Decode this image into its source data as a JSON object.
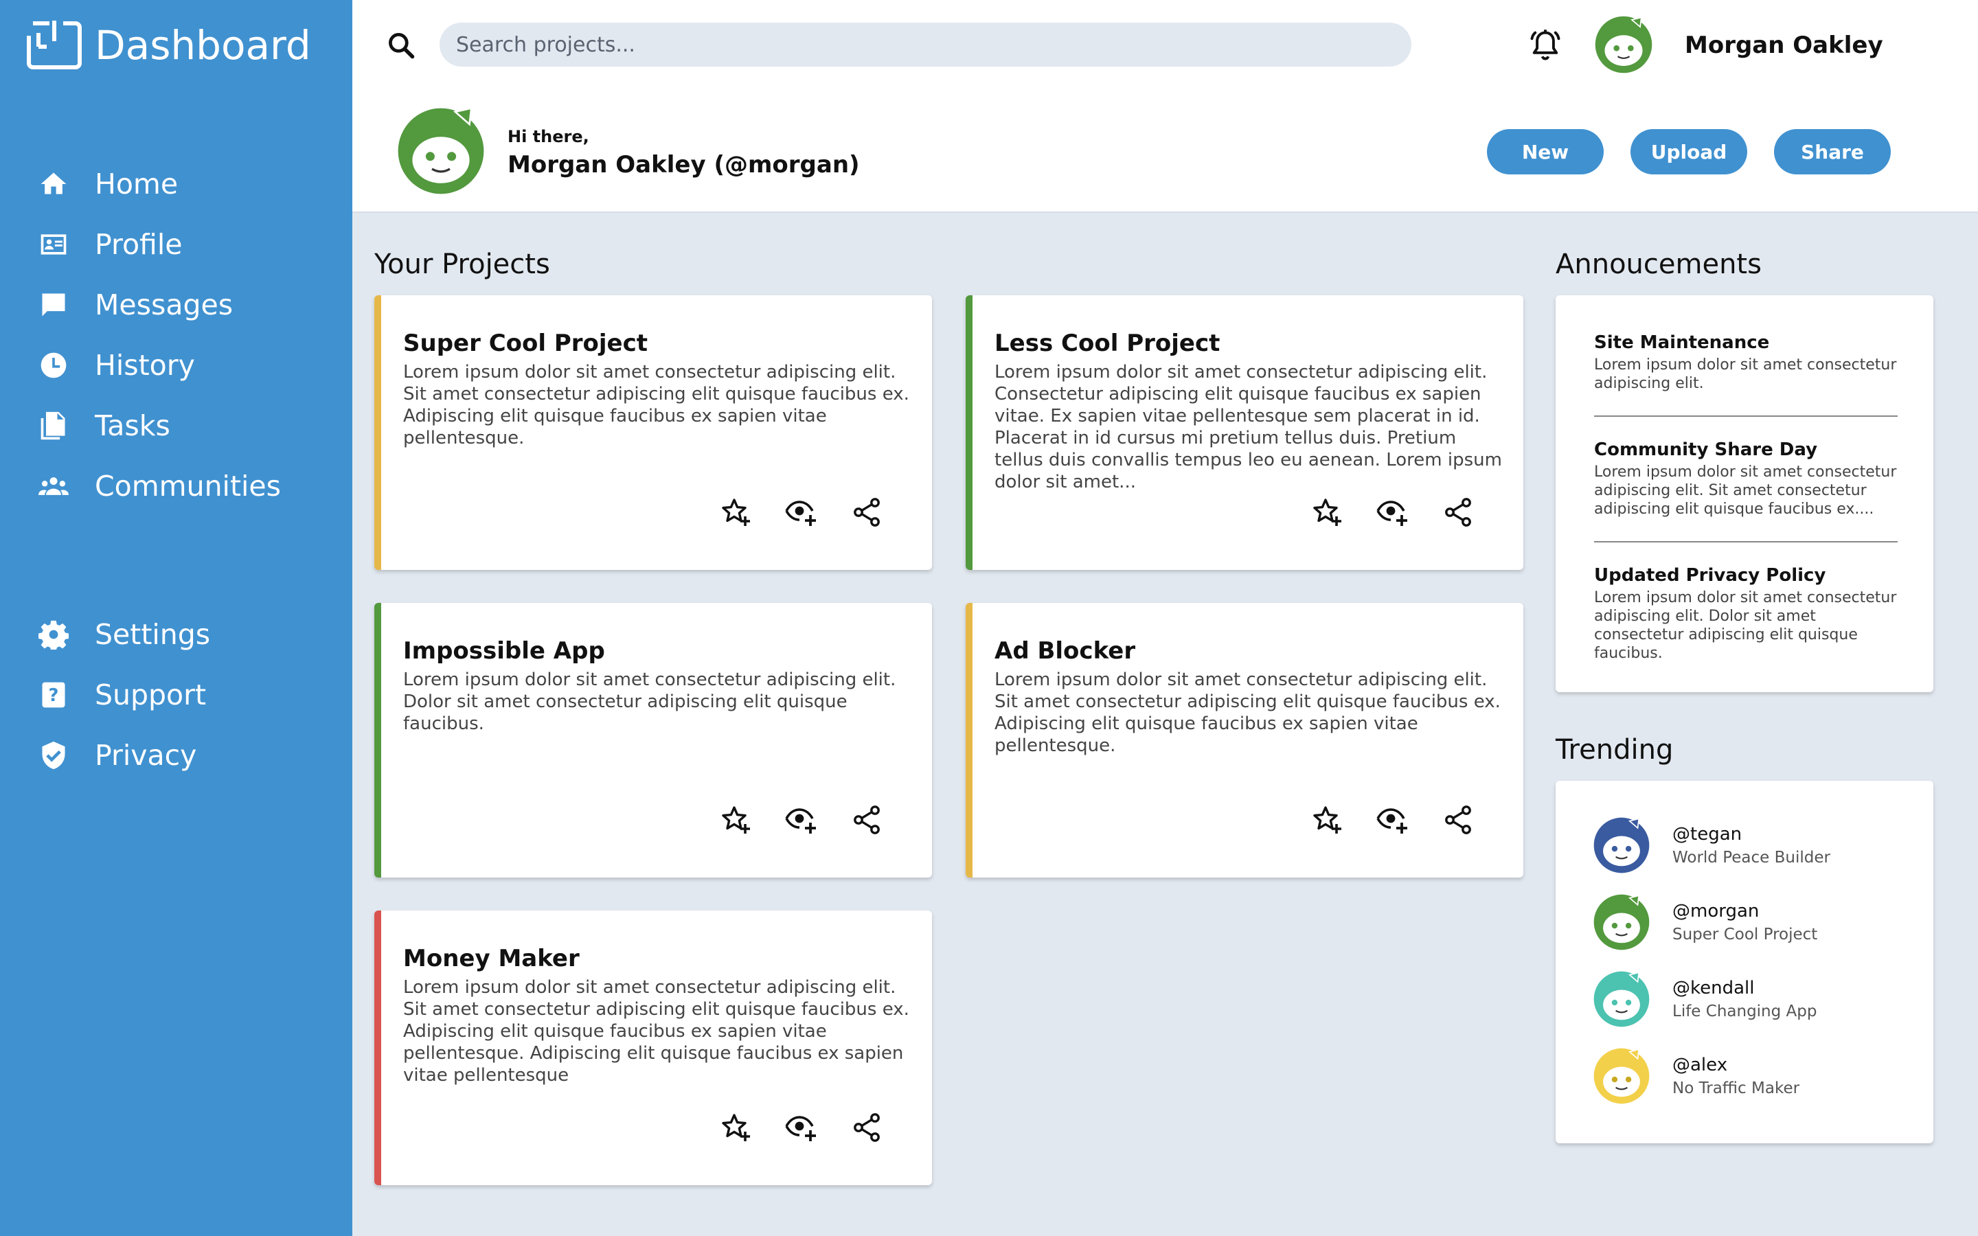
{
  "app": {
    "title": "Dashboard"
  },
  "sidebar": {
    "main_items": [
      {
        "label": "Home",
        "icon": "home-icon"
      },
      {
        "label": "Profile",
        "icon": "id-card-icon"
      },
      {
        "label": "Messages",
        "icon": "chat-bubble-icon"
      },
      {
        "label": "History",
        "icon": "clock-icon"
      },
      {
        "label": "Tasks",
        "icon": "documents-icon"
      },
      {
        "label": "Communities",
        "icon": "group-icon"
      }
    ],
    "bottom_items": [
      {
        "label": "Settings",
        "icon": "gear-icon"
      },
      {
        "label": "Support",
        "icon": "help-icon"
      },
      {
        "label": "Privacy",
        "icon": "shield-check-icon"
      }
    ]
  },
  "header": {
    "search_placeholder": "Search projects...",
    "user_name": "Morgan Oakley",
    "greeting": "Hi there,",
    "greeting_name": "Morgan Oakley (@morgan)",
    "buttons": {
      "new": "New",
      "upload": "Upload",
      "share": "Share"
    }
  },
  "projects": {
    "title": "Your Projects",
    "items": [
      {
        "title": "Super Cool Project",
        "accent": "#e6b84a",
        "description": "Lorem ipsum dolor sit amet consectetur adipiscing elit. Sit amet consectetur adipiscing elit quisque faucibus ex. Adipiscing elit quisque faucibus ex sapien vitae pellentesque."
      },
      {
        "title": "Less Cool Project",
        "accent": "#53993e",
        "description": "Lorem ipsum dolor sit amet consectetur adipiscing elit. Consectetur adipiscing elit quisque faucibus ex sapien vitae. Ex sapien vitae pellentesque sem placerat in id. Placerat in id cursus mi pretium tellus duis. Pretium tellus duis convallis tempus leo eu aenean. Lorem ipsum dolor sit amet..."
      },
      {
        "title": "Impossible App",
        "accent": "#53993e",
        "description": "Lorem ipsum dolor sit amet consectetur adipiscing elit. Dolor sit amet consectetur adipiscing elit quisque faucibus."
      },
      {
        "title": "Ad Blocker",
        "accent": "#e6b84a",
        "description": "Lorem ipsum dolor sit amet consectetur adipiscing elit. Sit amet consectetur adipiscing elit quisque faucibus ex. Adipiscing elit quisque faucibus ex sapien vitae pellentesque."
      },
      {
        "title": "Money Maker",
        "accent": "#d9534f",
        "description": "Lorem ipsum dolor sit amet consectetur adipiscing elit. Sit amet consectetur adipiscing elit quisque faucibus ex. Adipiscing elit quisque faucibus ex sapien vitae pellentesque. Adipiscing elit quisque faucibus ex sapien vitae pellentesque"
      }
    ]
  },
  "announcements": {
    "title": "Annoucements",
    "items": [
      {
        "title": "Site Maintenance",
        "description": "Lorem ipsum dolor sit amet consectetur adipiscing elit."
      },
      {
        "title": "Community Share Day",
        "description": "Lorem ipsum dolor sit amet consectetur adipiscing elit. Sit amet consectetur adipiscing elit quisque faucibus ex...."
      },
      {
        "title": "Updated Privacy Policy",
        "description": "Lorem ipsum dolor sit amet consectetur adipiscing elit. Dolor sit amet consectetur adipiscing elit quisque faucibus."
      }
    ]
  },
  "trending": {
    "title": "Trending",
    "items": [
      {
        "handle": "@tegan",
        "project": "World Peace Builder",
        "color": "#3a5ba0"
      },
      {
        "handle": "@morgan",
        "project": "Super Cool Project",
        "color": "#53993e"
      },
      {
        "handle": "@kendall",
        "project": "Life Changing App",
        "color": "#4cc2b0"
      },
      {
        "handle": "@alex",
        "project": "No Traffic Maker",
        "color": "#f2d04a"
      }
    ]
  },
  "colors": {
    "sidebar": "#4091d0",
    "background": "#e2e8f0",
    "accent_green": "#53993e",
    "accent_yellow": "#e6b84a",
    "accent_red": "#d9534f"
  }
}
